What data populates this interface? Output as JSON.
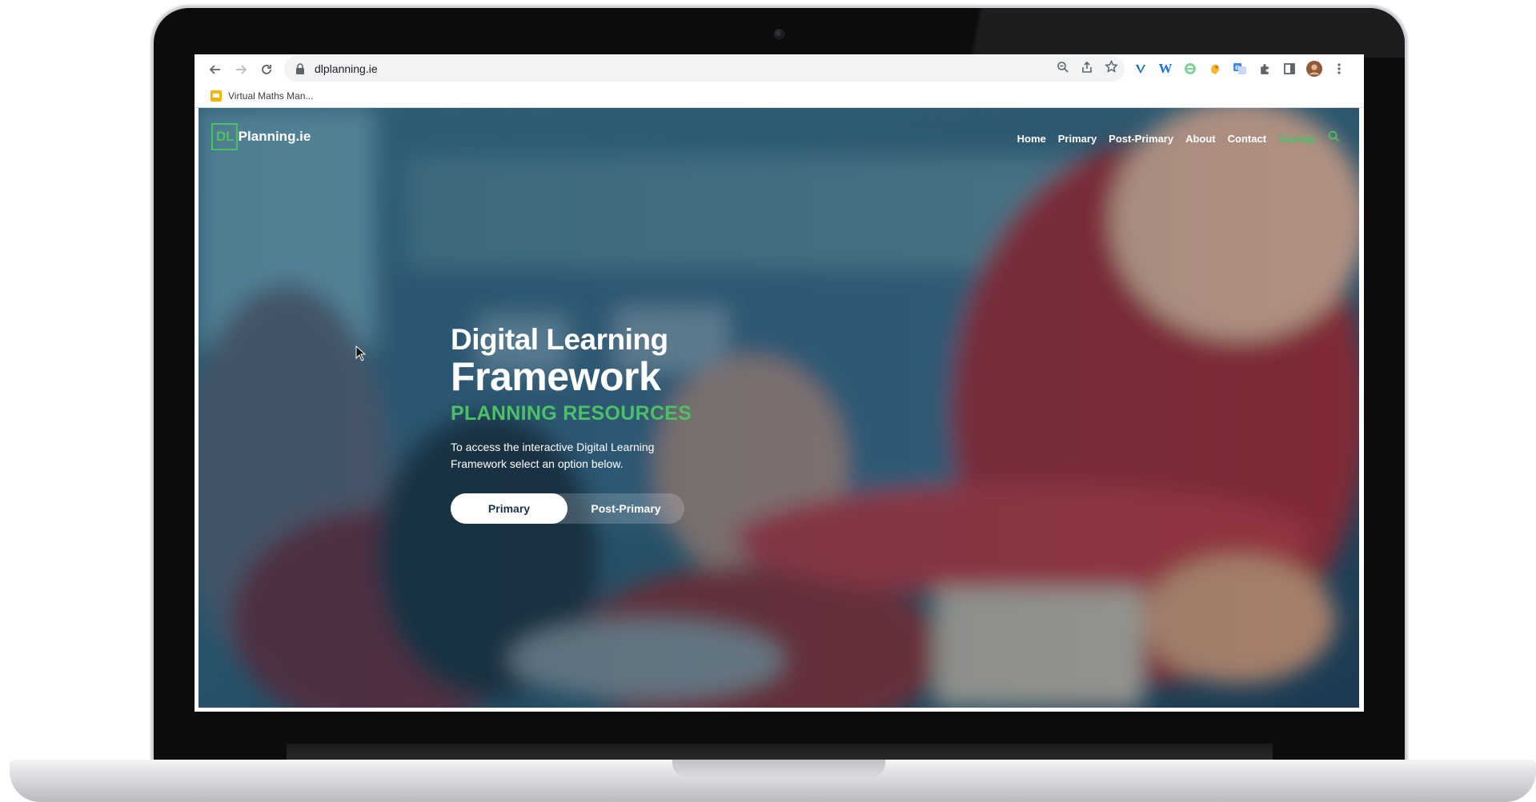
{
  "browser": {
    "url": "dlplanning.ie",
    "bookmark_label": "Virtual Maths Man...",
    "extensions": [
      "zoom-icon",
      "share-icon",
      "star-icon",
      "vimeo-ext-icon",
      "wikipedia-ext-icon",
      "grammarly-ext-icon",
      "hand-ext-icon",
      "translate-ext-icon",
      "puzzle-icon",
      "sidepanel-icon",
      "profile-avatar",
      "menu-icon"
    ]
  },
  "site": {
    "logo_dl": "DL",
    "logo_name": "Planning.ie",
    "nav": {
      "home": "Home",
      "primary": "Primary",
      "post_primary": "Post-Primary",
      "about": "About",
      "contact": "Contact",
      "gaeilge": "Gaeilge"
    },
    "accent_color": "#4cc064"
  },
  "hero": {
    "title_line1": "Digital Learning",
    "title_line2": "Framework",
    "subtitle": "PLANNING RESOURCES",
    "description": "To access the interactive Digital Learning Framework select an option below.",
    "primary_button": "Primary",
    "post_primary_button": "Post-Primary"
  }
}
